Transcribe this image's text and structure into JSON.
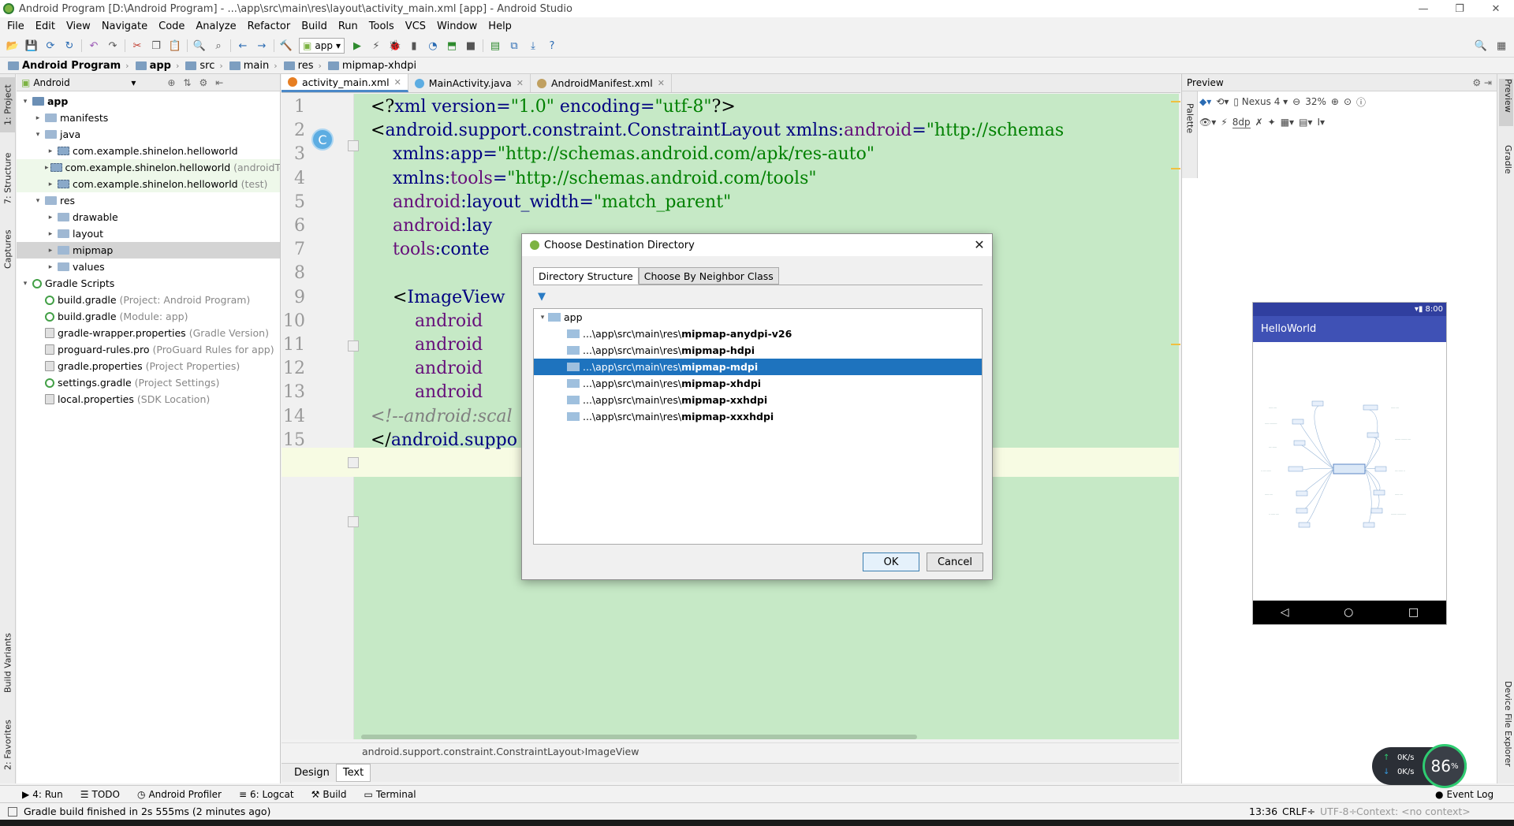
{
  "window": {
    "title": "Android Program [D:\\Android Program] - ...\\app\\src\\main\\res\\layout\\activity_main.xml [app] - Android Studio",
    "minimize": "—",
    "maximize": "❐",
    "close": "✕"
  },
  "menu": [
    "File",
    "Edit",
    "View",
    "Navigate",
    "Code",
    "Analyze",
    "Refactor",
    "Build",
    "Run",
    "Tools",
    "VCS",
    "Window",
    "Help"
  ],
  "toolbar": {
    "run_config": "app"
  },
  "breadcrumbs": [
    "Android Program",
    "app",
    "src",
    "main",
    "res",
    "mipmap-xhdpi"
  ],
  "left_stripe": {
    "project": "1: Project",
    "structure": "7: Structure",
    "captures": "Captures",
    "build_variants": "Build Variants",
    "favorites": "2: Favorites"
  },
  "project_panel": {
    "view_mode": "Android",
    "tree": [
      {
        "label": "app",
        "indent": 0,
        "arrow": "▾",
        "icon": "m",
        "bold": true
      },
      {
        "label": "manifests",
        "indent": 1,
        "arrow": "▸",
        "icon": "f"
      },
      {
        "label": "java",
        "indent": 1,
        "arrow": "▾",
        "icon": "f"
      },
      {
        "label": "com.example.shinelon.helloworld",
        "indent": 2,
        "arrow": "▸",
        "icon": "pk"
      },
      {
        "label": "com.example.shinelon.helloworld",
        "hint": "(androidTest)",
        "indent": 2,
        "arrow": "▸",
        "icon": "pk",
        "hl": true
      },
      {
        "label": "com.example.shinelon.helloworld",
        "hint": "(test)",
        "indent": 2,
        "arrow": "▸",
        "icon": "pk",
        "hl": true
      },
      {
        "label": "res",
        "indent": 1,
        "arrow": "▾",
        "icon": "f"
      },
      {
        "label": "drawable",
        "indent": 2,
        "arrow": "▸",
        "icon": "f"
      },
      {
        "label": "layout",
        "indent": 2,
        "arrow": "▸",
        "icon": "f"
      },
      {
        "label": "mipmap",
        "indent": 2,
        "arrow": "▸",
        "icon": "f",
        "sel": true
      },
      {
        "label": "values",
        "indent": 2,
        "arrow": "▸",
        "icon": "f"
      },
      {
        "label": "Gradle Scripts",
        "indent": 0,
        "arrow": "▾",
        "icon": "gr"
      },
      {
        "label": "build.gradle",
        "hint": "(Project: Android Program)",
        "indent": 1,
        "arrow": "",
        "icon": "gr"
      },
      {
        "label": "build.gradle",
        "hint": "(Module: app)",
        "indent": 1,
        "arrow": "",
        "icon": "gr"
      },
      {
        "label": "gradle-wrapper.properties",
        "hint": "(Gradle Version)",
        "indent": 1,
        "arrow": "",
        "icon": "prop"
      },
      {
        "label": "proguard-rules.pro",
        "hint": "(ProGuard Rules for app)",
        "indent": 1,
        "arrow": "",
        "icon": "prop"
      },
      {
        "label": "gradle.properties",
        "hint": "(Project Properties)",
        "indent": 1,
        "arrow": "",
        "icon": "prop"
      },
      {
        "label": "settings.gradle",
        "hint": "(Project Settings)",
        "indent": 1,
        "arrow": "",
        "icon": "gr"
      },
      {
        "label": "local.properties",
        "hint": "(SDK Location)",
        "indent": 1,
        "arrow": "",
        "icon": "prop"
      }
    ]
  },
  "editor": {
    "tabs": [
      {
        "label": "activity_main.xml",
        "active": true,
        "color": "#e67e22"
      },
      {
        "label": "MainActivity.java",
        "active": false,
        "color": "#5dade2"
      },
      {
        "label": "AndroidManifest.xml",
        "active": false,
        "color": "#c0a060"
      }
    ],
    "line_numbers": [
      "1",
      "2",
      "3",
      "4",
      "5",
      "6",
      "7",
      "8",
      "9",
      "10",
      "11",
      "12",
      "13",
      "14",
      "15"
    ],
    "lines": [
      [
        {
          "c": "t-pi",
          "t": "<?"
        },
        {
          "c": "t-tag",
          "t": "xml "
        },
        {
          "c": "t-attr",
          "t": "version="
        },
        {
          "c": "t-val",
          "t": "\"1.0\""
        },
        {
          "c": "t-attr",
          "t": " encoding="
        },
        {
          "c": "t-val",
          "t": "\"utf-8\""
        },
        {
          "c": "t-pi",
          "t": "?>"
        }
      ],
      [
        {
          "c": "t-pi",
          "t": "<"
        },
        {
          "c": "t-tag",
          "t": "android.support.constraint.ConstraintLayout "
        },
        {
          "c": "t-attr",
          "t": "xmlns:"
        },
        {
          "c": "t-ns",
          "t": "android"
        },
        {
          "c": "t-attr",
          "t": "="
        },
        {
          "c": "t-val",
          "t": "\"http://schemas"
        }
      ],
      [
        {
          "c": "t-attr",
          "t": "    xmlns:app="
        },
        {
          "c": "t-val",
          "t": "\"http://schemas.android.com/apk/res-auto\""
        }
      ],
      [
        {
          "c": "t-attr",
          "t": "    xmlns:"
        },
        {
          "c": "t-ns",
          "t": "tools"
        },
        {
          "c": "t-attr",
          "t": "="
        },
        {
          "c": "t-val",
          "t": "\"http://schemas.android.com/tools\""
        }
      ],
      [
        {
          "c": "t-ns",
          "t": "    android"
        },
        {
          "c": "t-attr",
          "t": ":layout_width="
        },
        {
          "c": "t-val",
          "t": "\"match_parent\""
        }
      ],
      [
        {
          "c": "t-ns",
          "t": "    android"
        },
        {
          "c": "t-attr",
          "t": ":lay"
        }
      ],
      [
        {
          "c": "t-ns",
          "t": "    tools"
        },
        {
          "c": "t-attr",
          "t": ":conte"
        }
      ],
      [
        {
          "c": "",
          "t": ""
        }
      ],
      [
        {
          "c": "t-pi",
          "t": "    <"
        },
        {
          "c": "t-tag",
          "t": "ImageView"
        }
      ],
      [
        {
          "c": "t-ns",
          "t": "        android"
        }
      ],
      [
        {
          "c": "t-ns",
          "t": "        android"
        }
      ],
      [
        {
          "c": "t-ns",
          "t": "        android"
        }
      ],
      [
        {
          "c": "t-ns",
          "t": "        android"
        }
      ],
      [
        {
          "c": "t-com",
          "t": "<!--android:scal"
        }
      ],
      [
        {
          "c": "t-pi",
          "t": "</"
        },
        {
          "c": "t-tag",
          "t": "android.suppo"
        }
      ]
    ],
    "status_crumbs": [
      "android.support.constraint.ConstraintLayout",
      "ImageView"
    ],
    "bottom_tabs": [
      "Design",
      "Text"
    ]
  },
  "preview": {
    "title": "Preview",
    "palette": "Palette",
    "device": "Nexus 4",
    "zoom": "32%",
    "margin": "8dp",
    "app_bar_title": "HelloWorld",
    "time": "8:00",
    "nav": [
      "◁",
      "○",
      "□"
    ],
    "right_stripe": {
      "preview": "Preview",
      "gradle": "Gradle",
      "device_explorer": "Device File Explorer"
    }
  },
  "dialog": {
    "title": "Choose Destination Directory",
    "tabs": [
      "Directory Structure",
      "Choose By Neighbor Class"
    ],
    "root": "app",
    "items": [
      {
        "prefix": "...\\app\\src\\main\\res\\",
        "name": "mipmap-anydpi-v26",
        "selected": false
      },
      {
        "prefix": "...\\app\\src\\main\\res\\",
        "name": "mipmap-hdpi",
        "selected": false
      },
      {
        "prefix": "...\\app\\src\\main\\res\\",
        "name": "mipmap-mdpi",
        "selected": true
      },
      {
        "prefix": "...\\app\\src\\main\\res\\",
        "name": "mipmap-xhdpi",
        "selected": false
      },
      {
        "prefix": "...\\app\\src\\main\\res\\",
        "name": "mipmap-xxhdpi",
        "selected": false
      },
      {
        "prefix": "...\\app\\src\\main\\res\\",
        "name": "mipmap-xxxhdpi",
        "selected": false
      }
    ],
    "ok": "OK",
    "cancel": "Cancel"
  },
  "tool_windows": [
    "4: Run",
    "TODO",
    "Android Profiler",
    "6: Logcat",
    "Build",
    "Terminal"
  ],
  "event_log": "Event Log",
  "network": {
    "up": "0K/s",
    "down": "0K/s",
    "cpu": "86",
    "cpu_unit": "%"
  },
  "status": {
    "message": "Gradle build finished in 2s 555ms (2 minutes ago)",
    "position": "13:36",
    "line_sep": "CRLF÷",
    "encoding": "UTF-8÷",
    "context": "Context: <no context>"
  }
}
